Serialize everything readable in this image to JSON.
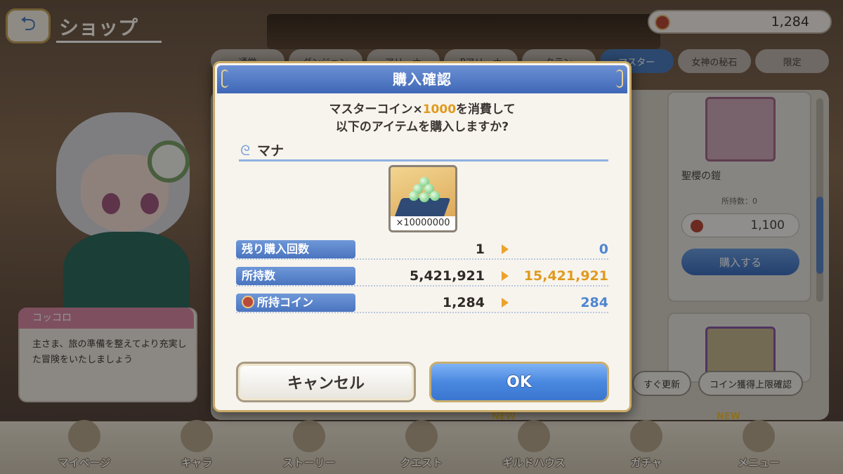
{
  "header": {
    "title": "ショップ",
    "coin_balance": "1,284"
  },
  "tabs": [
    {
      "label": "通常",
      "active": false
    },
    {
      "label": "ダンジョン",
      "active": false
    },
    {
      "label": "アリーナ",
      "active": false
    },
    {
      "label": "Pアリーナ",
      "active": false
    },
    {
      "label": "クラン",
      "active": false
    },
    {
      "label": "マスター",
      "active": true
    },
    {
      "label": "女神の秘石",
      "active": false
    },
    {
      "label": "限定",
      "active": false
    }
  ],
  "shop_item": {
    "name": "聖櫻の鎧",
    "owned": "所持数：0",
    "price": "1,100",
    "buy_label": "購入する"
  },
  "bottom_buttons": [
    "すぐ更新",
    "コイン獲得上限確認"
  ],
  "speech": {
    "name": "コッコロ",
    "text": "主さま、旅の準備を整えてより充実した冒険をいたしましょう"
  },
  "nav": [
    {
      "label": "マイページ",
      "new": false
    },
    {
      "label": "キャラ",
      "new": false
    },
    {
      "label": "ストーリー",
      "new": false
    },
    {
      "label": "クエスト",
      "new": false
    },
    {
      "label": "ギルドハウス",
      "new": true
    },
    {
      "label": "ガチャ",
      "new": false
    },
    {
      "label": "メニュー",
      "new": true
    }
  ],
  "dialog": {
    "title": "購入確認",
    "message_prefix": "マスターコイン×",
    "message_amount": "1000",
    "message_suffix": "を消費して",
    "message_line2": "以下のアイテムを購入しますか?",
    "item_name": "マナ",
    "item_qty": "×10000000",
    "rows": [
      {
        "label": "残り購入回数",
        "before": "1",
        "after": "0",
        "after_color": "#4f86d0",
        "coin_icon": false
      },
      {
        "label": "所持数",
        "before": "5,421,921",
        "after": "15,421,921",
        "after_color": "#e09a1e",
        "coin_icon": false
      },
      {
        "label": "所持コイン",
        "before": "1,284",
        "after": "284",
        "after_color": "#4f86d0",
        "coin_icon": true
      }
    ],
    "cancel_label": "キャンセル",
    "ok_label": "OK"
  }
}
